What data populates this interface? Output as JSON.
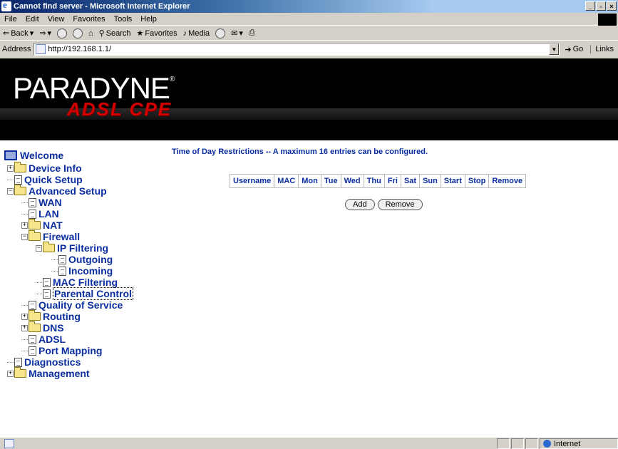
{
  "window": {
    "title": "Cannot find server - Microsoft Internet Explorer"
  },
  "menu": [
    "File",
    "Edit",
    "View",
    "Favorites",
    "Tools",
    "Help"
  ],
  "toolbar": {
    "back": "Back",
    "search": "Search",
    "favorites": "Favorites",
    "media": "Media"
  },
  "address": {
    "label": "Address",
    "url": "http://192.168.1.1/",
    "go": "Go",
    "links": "Links"
  },
  "banner": {
    "brand": "PARADYNE",
    "registered": "®",
    "product": "ADSL CPE"
  },
  "tree": [
    "Welcome",
    "Device Info",
    "Quick Setup",
    "Advanced Setup",
    "WAN",
    "LAN",
    "NAT",
    "Firewall",
    "IP Filtering",
    "Outgoing",
    "Incoming",
    "MAC Filtering",
    "Parental Control",
    "Quality of Service",
    "Routing",
    "DNS",
    "ADSL",
    "Port Mapping",
    "Diagnostics",
    "Management"
  ],
  "main": {
    "title": "Time of Day Restrictions -- A maximum 16 entries can be configured.",
    "columns": [
      "Username",
      "MAC",
      "Mon",
      "Tue",
      "Wed",
      "Thu",
      "Fri",
      "Sat",
      "Sun",
      "Start",
      "Stop",
      "Remove"
    ],
    "add_label": "Add",
    "remove_label": "Remove"
  },
  "status": {
    "zone": "Internet"
  }
}
